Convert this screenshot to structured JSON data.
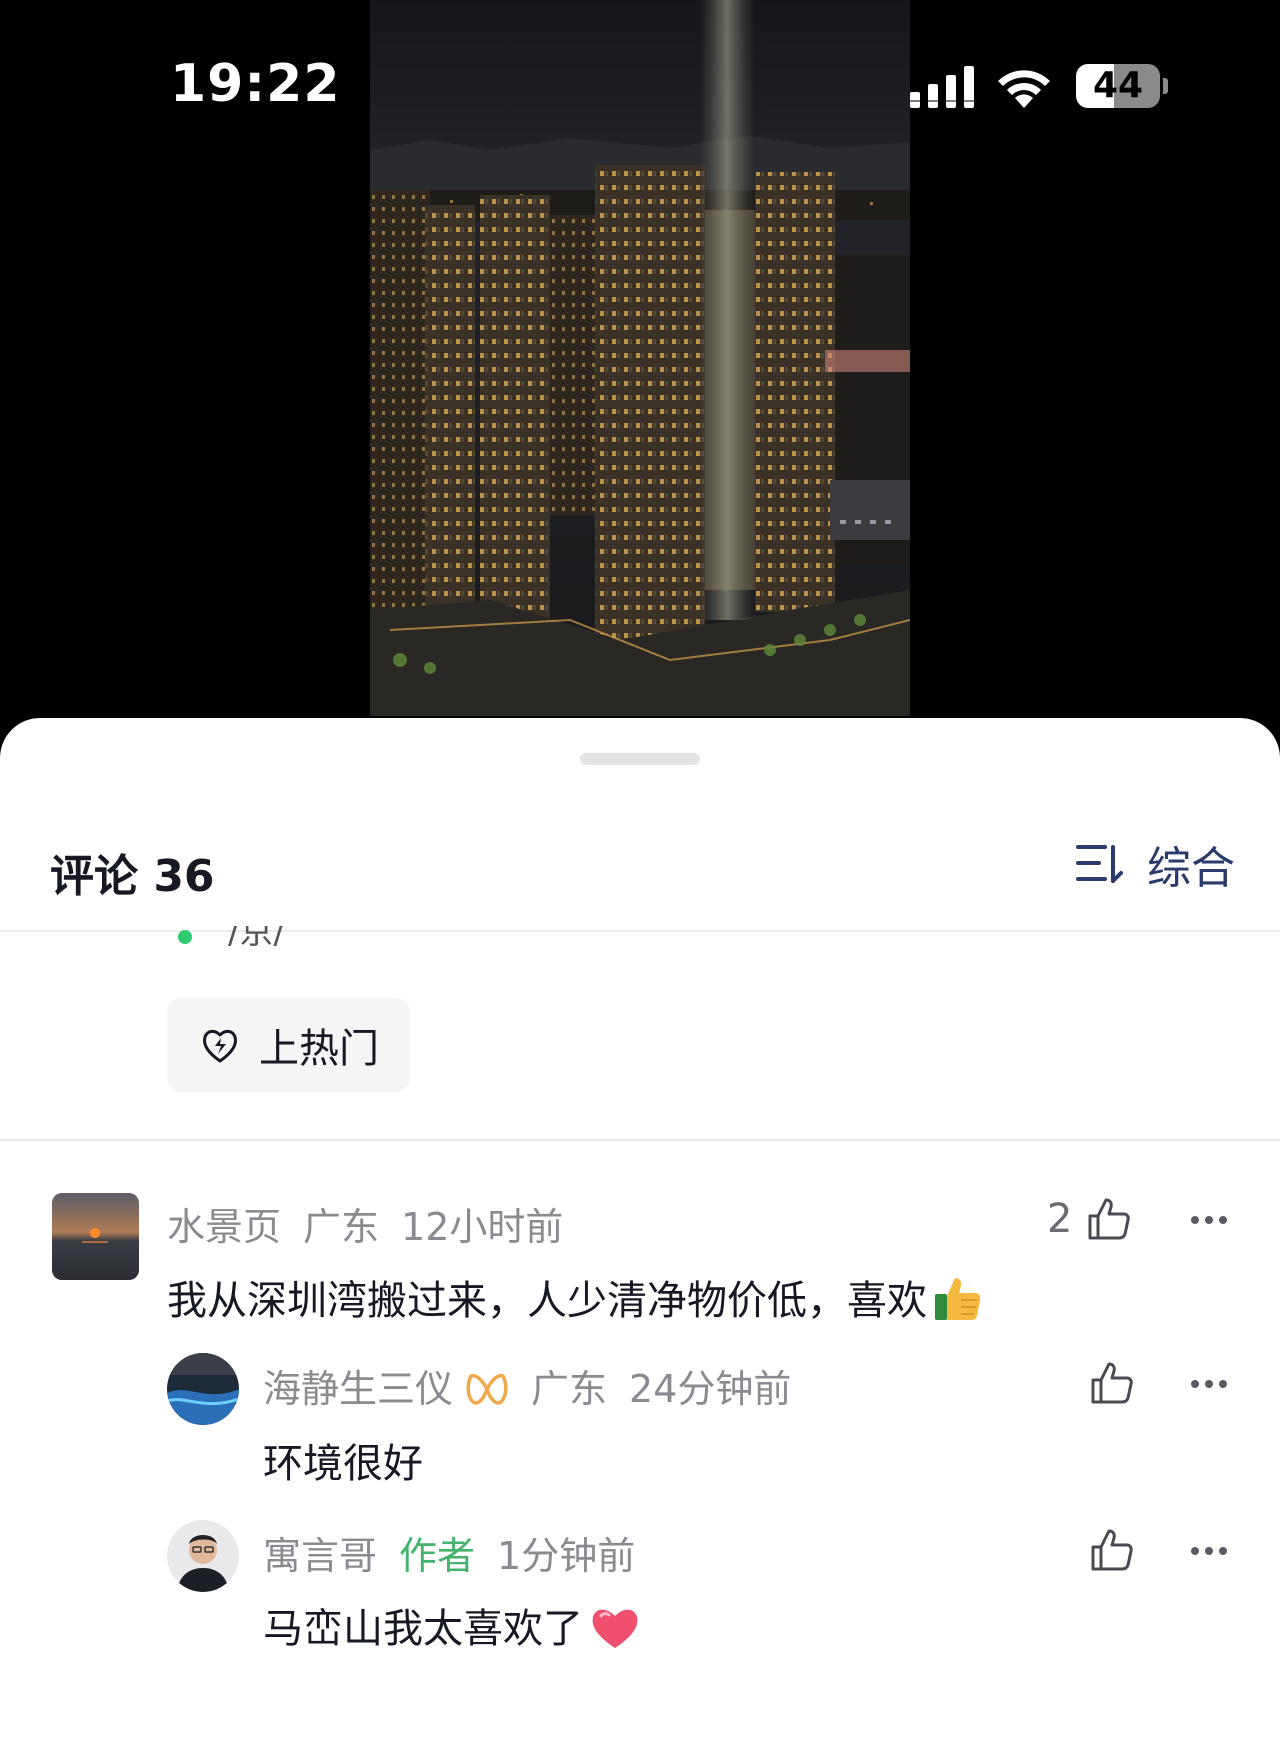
{
  "status_bar": {
    "time": "19:22",
    "battery": "44"
  },
  "comments_panel": {
    "title": "评论 36",
    "sort_label": "综合",
    "hot_button_label": "上热门",
    "partial_line_text": "/京/"
  },
  "comments": [
    {
      "username": "水景页",
      "location": "广东",
      "time": "12小时前",
      "text": "我从深圳湾搬过来，人少清净物价低，喜欢",
      "emoji": "thumbs-up-emoji",
      "likes": "2"
    }
  ],
  "replies": [
    {
      "username": "海静生三仪",
      "badge": "infinity-badge-icon",
      "location": "广东",
      "time": "24分钟前",
      "text": "环境很好"
    },
    {
      "username": "寓言哥",
      "tag": "作者",
      "time": "1分钟前",
      "text": "马峦山我太喜欢了",
      "emoji": "red-heart-emoji"
    }
  ],
  "colors": {
    "author_tag": "#45b36b",
    "meta_text": "#8a8b91",
    "sort_accent": "#2a3a6a"
  }
}
